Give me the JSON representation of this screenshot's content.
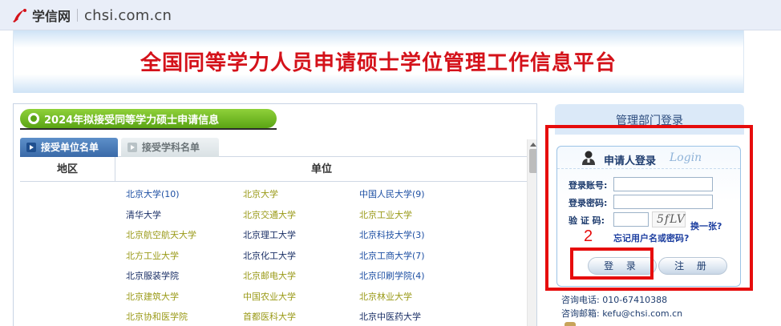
{
  "header": {
    "logo_name": "学信网",
    "logo_domain": "chsi.com.cn"
  },
  "banner": {
    "title": "全国同等学力人员申请硕士学位管理工作信息平台"
  },
  "section": {
    "title": "2024年拟接受同等学力硕士申请信息",
    "tabs": [
      "接受单位名单",
      "接受学科名单"
    ],
    "active_tab": "接受单位名单",
    "table_headers": {
      "region": "地区",
      "unit": "单位"
    },
    "schools": [
      [
        {
          "name": "北京大学(10)",
          "color": "#1d4fa3"
        },
        {
          "name": "北京大学",
          "color": "#9a9a18"
        },
        {
          "name": "中国人民大学(9)",
          "color": "#1d4fa3"
        }
      ],
      [
        {
          "name": "清华大学",
          "color": "#1a2f66"
        },
        {
          "name": "北京交通大学",
          "color": "#9a9a18"
        },
        {
          "name": "北京工业大学",
          "color": "#9a9a18"
        }
      ],
      [
        {
          "name": "北京航空航天大学",
          "color": "#9a9a18"
        },
        {
          "name": "北京理工大学",
          "color": "#1a2f66"
        },
        {
          "name": "北京科技大学(3)",
          "color": "#1d4fa3"
        }
      ],
      [
        {
          "name": "北方工业大学",
          "color": "#9a9a18"
        },
        {
          "name": "北京化工大学",
          "color": "#1a2f66"
        },
        {
          "name": "北京工商大学(7)",
          "color": "#1d4fa3"
        }
      ],
      [
        {
          "name": "北京服装学院",
          "color": "#1a2f66"
        },
        {
          "name": "北京邮电大学",
          "color": "#9a9a18"
        },
        {
          "name": "北京印刷学院(4)",
          "color": "#1d4fa3"
        }
      ],
      [
        {
          "name": "北京建筑大学",
          "color": "#9a9a18"
        },
        {
          "name": "中国农业大学",
          "color": "#9a9a18"
        },
        {
          "name": "北京林业大学",
          "color": "#9a9a18"
        }
      ],
      [
        {
          "name": "北京协和医学院",
          "color": "#9a9a18"
        },
        {
          "name": "首都医科大学",
          "color": "#9a9a18"
        },
        {
          "name": "北京中医药大学",
          "color": "#1a2f66"
        }
      ]
    ]
  },
  "right_panel": {
    "header": "管理部门登录",
    "login": {
      "title": "申请人登录",
      "title_en": "Login",
      "account_label": "登录账号:",
      "password_label": "登录密码:",
      "captcha_label": "验 证 码:",
      "captcha_text": "5fLV",
      "switch_link": "换一张?",
      "forgot_link": "忘记用户名或密码?",
      "login_button": "登 录",
      "register_button": "注 册"
    },
    "contact": {
      "tel": "咨询电话: 010-67410388",
      "mail": "咨询邮箱: kefu@chsi.com.cn"
    }
  },
  "annotation": {
    "label": "2",
    "color": "#e60c0c"
  },
  "colors": {
    "accent_green": "#5aa414",
    "banner_red": "#d4121a",
    "tab_blue": "#3a6aa8"
  }
}
